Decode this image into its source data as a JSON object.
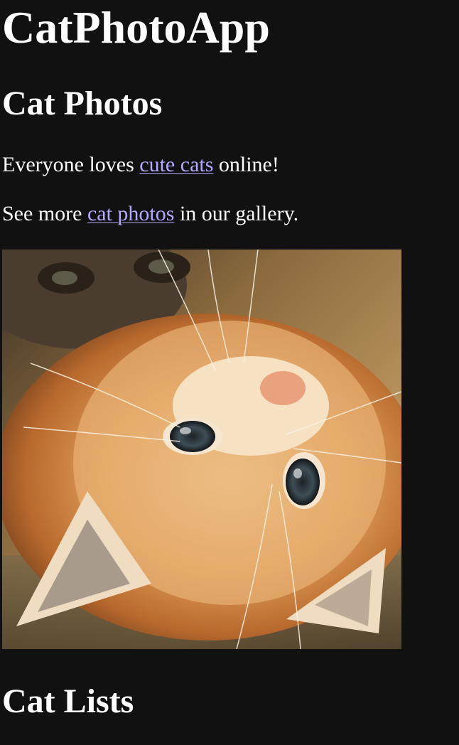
{
  "header": {
    "title": "CatPhotoApp"
  },
  "photos_section": {
    "heading": "Cat Photos",
    "intro_before": "Everyone loves ",
    "intro_link": "cute cats",
    "intro_after": " online!",
    "gallery_before": "See more ",
    "gallery_link": "cat photos",
    "gallery_after": " in our gallery."
  },
  "lists_section": {
    "heading": "Cat Lists"
  },
  "colors": {
    "background": "#111111",
    "text": "#ffffff",
    "link": "#b3a9ff"
  }
}
